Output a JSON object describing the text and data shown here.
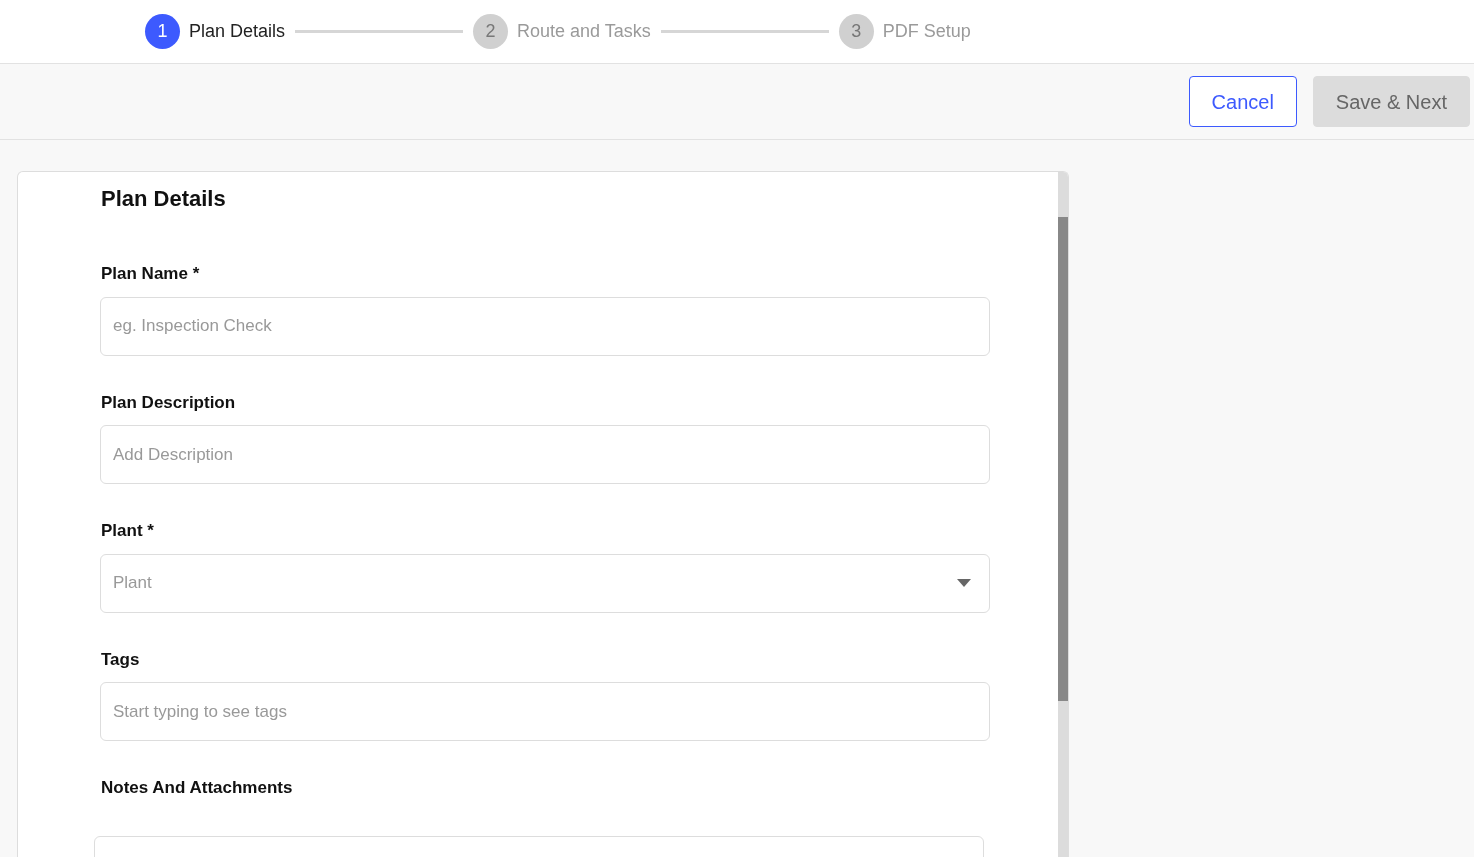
{
  "stepper": [
    {
      "number": "1",
      "label": "Plan Details",
      "selected": true
    },
    {
      "number": "2",
      "label": "Route and Tasks",
      "selected": false
    },
    {
      "number": "3",
      "label": "PDF Setup",
      "selected": false
    }
  ],
  "toolbar": {
    "buttons": [
      {
        "label": "Cancel",
        "kind": "outline",
        "disabled": false
      },
      {
        "label": "Save & Next",
        "kind": "solid",
        "disabled": true
      }
    ]
  },
  "form": {
    "title": "Plan Details",
    "fields": [
      {
        "label": "Plan Name *",
        "kind": "text",
        "placeholder": "eg. Inspection Check"
      },
      {
        "label": "Plan Description",
        "kind": "text",
        "placeholder": "Add Description"
      },
      {
        "label": "Plant *",
        "kind": "select",
        "placeholder": "Plant"
      },
      {
        "label": "Tags",
        "kind": "text",
        "placeholder": "Start typing to see tags"
      },
      {
        "label": "Notes And Attachments",
        "kind": "textarea"
      }
    ]
  }
}
